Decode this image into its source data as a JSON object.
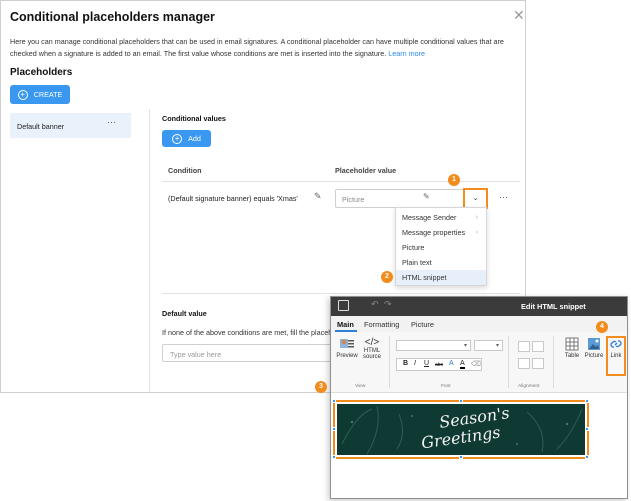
{
  "dialog": {
    "title": "Conditional placeholders manager",
    "description": "Here you can manage conditional placeholders that can be used in email signatures. A conditional placeholder can have multiple conditional values that are checked when a signature is added to an email. The first value whose conditions are met is inserted into the signature.",
    "learn_more": "Learn more",
    "placeholders_title": "Placeholders",
    "create_label": "CREATE"
  },
  "sidebar": {
    "items": [
      {
        "label": "Default banner",
        "more": "···"
      }
    ]
  },
  "conditional_values": {
    "title": "Conditional values",
    "add_label": "Add",
    "col_condition": "Condition",
    "col_placeholder": "Placeholder value",
    "rows": [
      {
        "condition": "(Default signature banner) equals 'Xmas'",
        "value": "Picture",
        "more": "···"
      }
    ]
  },
  "menu": {
    "items": [
      {
        "label": "Message Sender",
        "arrow": "›"
      },
      {
        "label": "Message properties",
        "arrow": "›"
      },
      {
        "label": "Picture",
        "arrow": ""
      },
      {
        "label": "Plain text",
        "arrow": ""
      },
      {
        "label": "HTML snippet",
        "arrow": ""
      }
    ]
  },
  "default_value": {
    "title": "Default value",
    "description": "If none of the above conditions are met, fill the placeholder",
    "placeholder": "Type value here"
  },
  "editor": {
    "title": "Edit HTML snippet",
    "tabs": [
      "Main",
      "Formatting",
      "Picture"
    ],
    "preview_label": "Preview",
    "html_source_label": "HTML source",
    "group_view": "View",
    "group_font": "Font",
    "group_alignment": "Alignment",
    "table_label": "Table",
    "picture_label": "Picture",
    "link_label": "Link",
    "banner_line1": "Season's",
    "banner_line2": "Greetings"
  },
  "badges": [
    "1",
    "2",
    "3",
    "4"
  ],
  "colors": {
    "accent": "#3b98f0",
    "highlight": "#f28c1c",
    "banner_bg": "#0f3a33"
  }
}
